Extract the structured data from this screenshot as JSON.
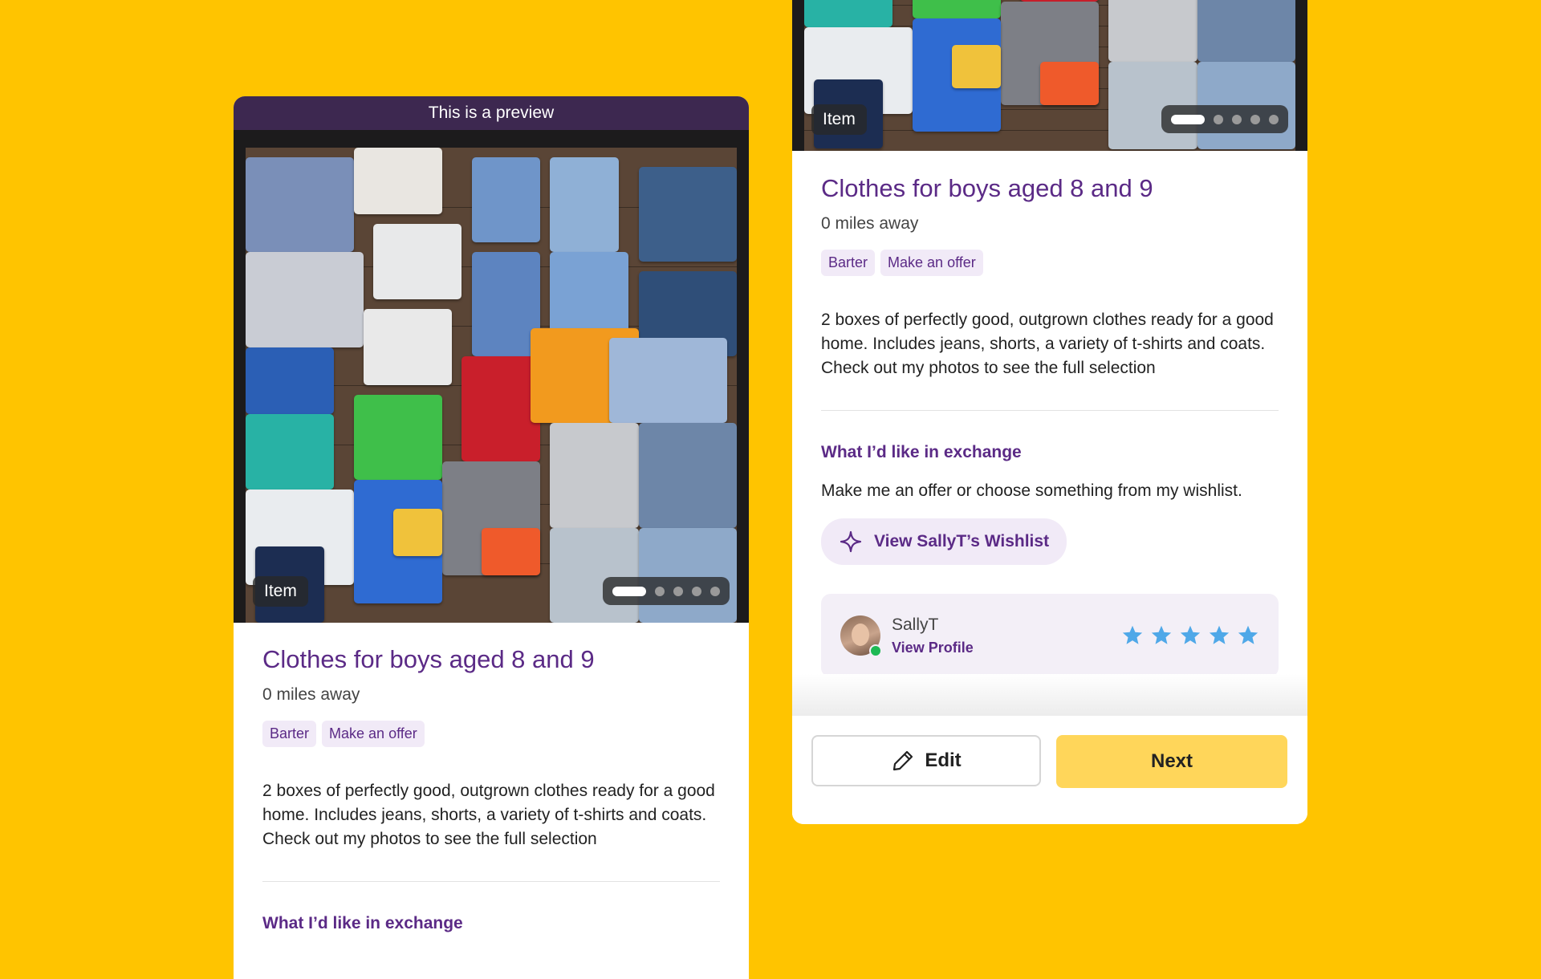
{
  "preview_banner": "This is a preview",
  "listing": {
    "photo_label": "Item",
    "photo_count": 5,
    "active_photo": 1,
    "title": "Clothes for boys aged 8 and 9",
    "distance": "0 miles away",
    "tags": [
      "Barter",
      "Make an offer"
    ],
    "description": "2 boxes of perfectly good, outgrown clothes ready for a good home. Includes jeans, shorts, a variety of t-shirts and coats. Check out my photos to see the full selection",
    "exchange_heading": "What I’d like in exchange",
    "exchange_text": "Make me an offer or choose something from my wishlist.",
    "wishlist_button": "View SallyT’s Wishlist"
  },
  "profile": {
    "name": "SallyT",
    "link": "View Profile",
    "rating": 5,
    "online": true
  },
  "footer": {
    "edit_label": "Edit",
    "next_label": "Next"
  },
  "colors": {
    "background": "#FFC400",
    "brand_purple": "#5B2A86",
    "banner": "#3D2850",
    "tag_bg": "#F1EAF7",
    "next_button": "#FFD65A",
    "star": "#4FA8E8",
    "online": "#1DB954"
  }
}
